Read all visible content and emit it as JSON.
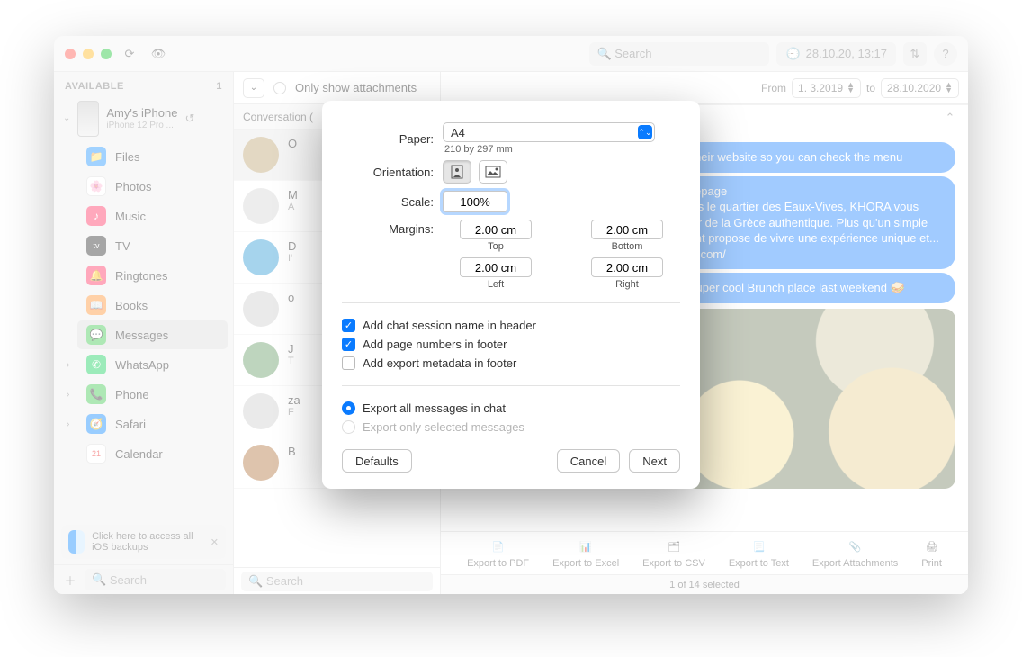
{
  "titlebar": {
    "search_placeholder": "Search",
    "date_display": "28.10.20, 13:17"
  },
  "sidebar": {
    "header": "AVAILABLE",
    "count": "1",
    "device": {
      "name": "Amy's iPhone",
      "sub": "iPhone 12 Pro ..."
    },
    "items": [
      {
        "label": "Files",
        "color": "#2f9bff",
        "glyph": "📁"
      },
      {
        "label": "Photos",
        "color": "#ffffff",
        "glyph": "🌸"
      },
      {
        "label": "Music",
        "color": "#ff3e6c",
        "glyph": "♪"
      },
      {
        "label": "TV",
        "color": "#3a3a3a",
        "glyph": "tv"
      },
      {
        "label": "Ringtones",
        "color": "#ff3e6c",
        "glyph": "🔔"
      },
      {
        "label": "Books",
        "color": "#ff9a3e",
        "glyph": "📖"
      },
      {
        "label": "Messages",
        "color": "#4dcc5b",
        "glyph": "💬",
        "active": true
      },
      {
        "label": "WhatsApp",
        "color": "#25d366",
        "glyph": "✆",
        "chev": true
      },
      {
        "label": "Phone",
        "color": "#4dcc5b",
        "glyph": "📞",
        "chev": true
      },
      {
        "label": "Safari",
        "color": "#1e90ff",
        "glyph": "🧭",
        "chev": true
      },
      {
        "label": "Calendar",
        "color": "#ffffff",
        "glyph": "21"
      }
    ],
    "hint": "Click here to access all iOS backups",
    "bottom_search_placeholder": "Search"
  },
  "midcol": {
    "only_attachments": "Only show attachments",
    "conversation_hdr": "Conversation (",
    "search_placeholder": "Search",
    "items": [
      {
        "name": "O",
        "preview": "",
        "sel": true
      },
      {
        "name": "M",
        "preview": "A"
      },
      {
        "name": "D",
        "preview": "I'"
      },
      {
        "name": "o",
        "preview": ""
      },
      {
        "name": "J",
        "preview": "T"
      },
      {
        "name": "za",
        "preview": "F"
      },
      {
        "name": "B",
        "preview": ""
      }
    ]
  },
  "chat": {
    "from_label": "From",
    "date_from": "1.  3.2019",
    "to_label": "to",
    "date_to": "28.10.2020",
    "bubbles": [
      "to their website so you can check the menu",
      "omepage\n dans le quartier des Eaux-Vives, KHORA vous\npeur de la Grèce authentique. Plus qu'un simple\nurant propose de vivre une expérience unique et...\neve.com/",
      "is super cool Brunch place last weekend 🥪"
    ],
    "tools": [
      "Export to PDF",
      "Export to Excel",
      "Export to CSV",
      "Export to Text",
      "Export Attachments",
      "Print"
    ],
    "status": "1 of 14 selected"
  },
  "modal": {
    "paper_label": "Paper:",
    "paper_value": "A4",
    "paper_dims": "210 by 297 mm",
    "orientation_label": "Orientation:",
    "scale_label": "Scale:",
    "scale_value": "100%",
    "margins_label": "Margins:",
    "margins": {
      "top": "2.00 cm",
      "bottom": "2.00 cm",
      "left": "2.00 cm",
      "right": "2.00 cm"
    },
    "margin_lbls": {
      "top": "Top",
      "bottom": "Bottom",
      "left": "Left",
      "right": "Right"
    },
    "chk_header": "Add chat session name in header",
    "chk_footer_pages": "Add page numbers in footer",
    "chk_footer_meta": "Add export metadata in footer",
    "rad_all": "Export all messages in chat",
    "rad_sel": "Export only selected messages",
    "btn_defaults": "Defaults",
    "btn_cancel": "Cancel",
    "btn_next": "Next"
  }
}
